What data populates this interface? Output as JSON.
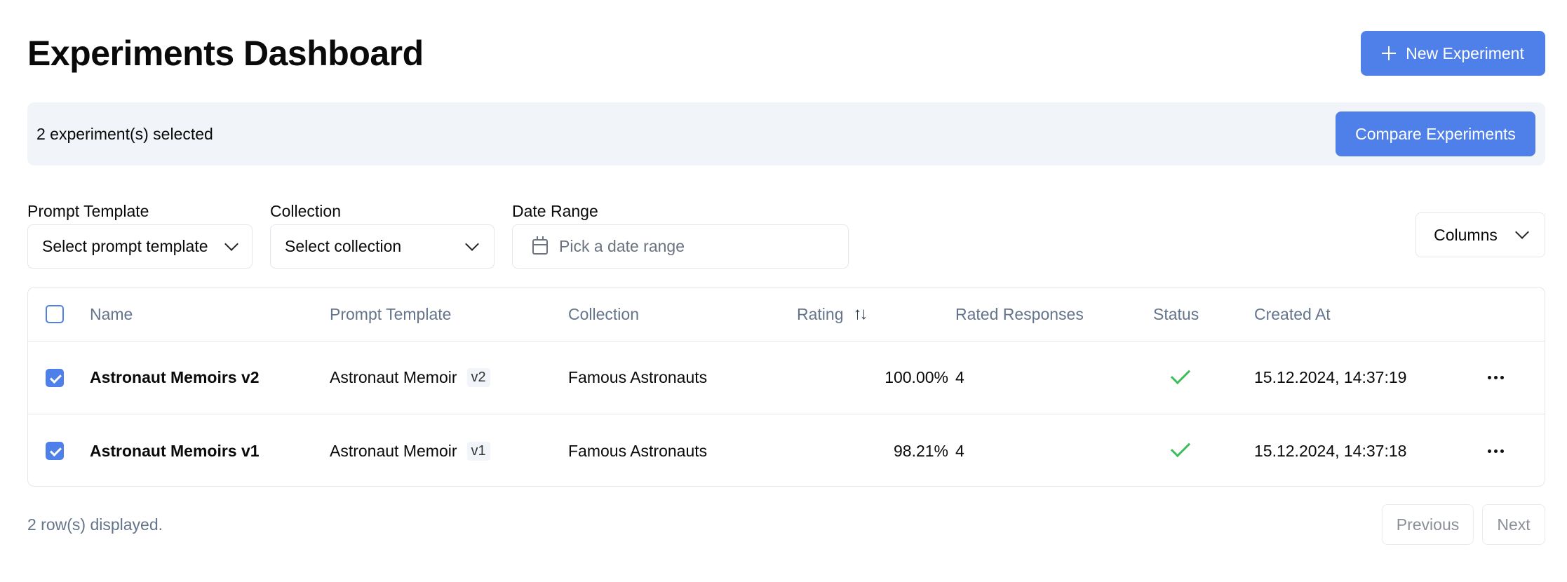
{
  "header": {
    "title": "Experiments Dashboard",
    "new_button": "New Experiment"
  },
  "selection": {
    "text": "2 experiment(s) selected",
    "compare_button": "Compare Experiments"
  },
  "filters": {
    "prompt_template": {
      "label": "Prompt Template",
      "value": "Select prompt template"
    },
    "collection": {
      "label": "Collection",
      "value": "Select collection"
    },
    "date_range": {
      "label": "Date Range",
      "placeholder": "Pick a date range"
    },
    "columns_button": "Columns"
  },
  "table": {
    "headers": {
      "name": "Name",
      "prompt_template": "Prompt Template",
      "collection": "Collection",
      "rating": "Rating",
      "rated_responses": "Rated Responses",
      "status": "Status",
      "created_at": "Created At"
    },
    "rows": [
      {
        "checked": true,
        "name": "Astronaut Memoirs v2",
        "prompt_template": "Astronaut Memoir",
        "version": "v2",
        "collection": "Famous Astronauts",
        "rating": "100.00%",
        "rated_responses": "4",
        "status": "success",
        "created_at": "15.12.2024, 14:37:19"
      },
      {
        "checked": true,
        "name": "Astronaut Memoirs v1",
        "prompt_template": "Astronaut Memoir",
        "version": "v1",
        "collection": "Famous Astronauts",
        "rating": "98.21%",
        "rated_responses": "4",
        "status": "success",
        "created_at": "15.12.2024, 14:37:18"
      }
    ]
  },
  "footer": {
    "rows_text": "2 row(s) displayed.",
    "previous": "Previous",
    "next": "Next"
  },
  "colors": {
    "accent": "#4f80ea",
    "success": "#3fbd5c",
    "muted_bg": "#f1f4f9"
  }
}
